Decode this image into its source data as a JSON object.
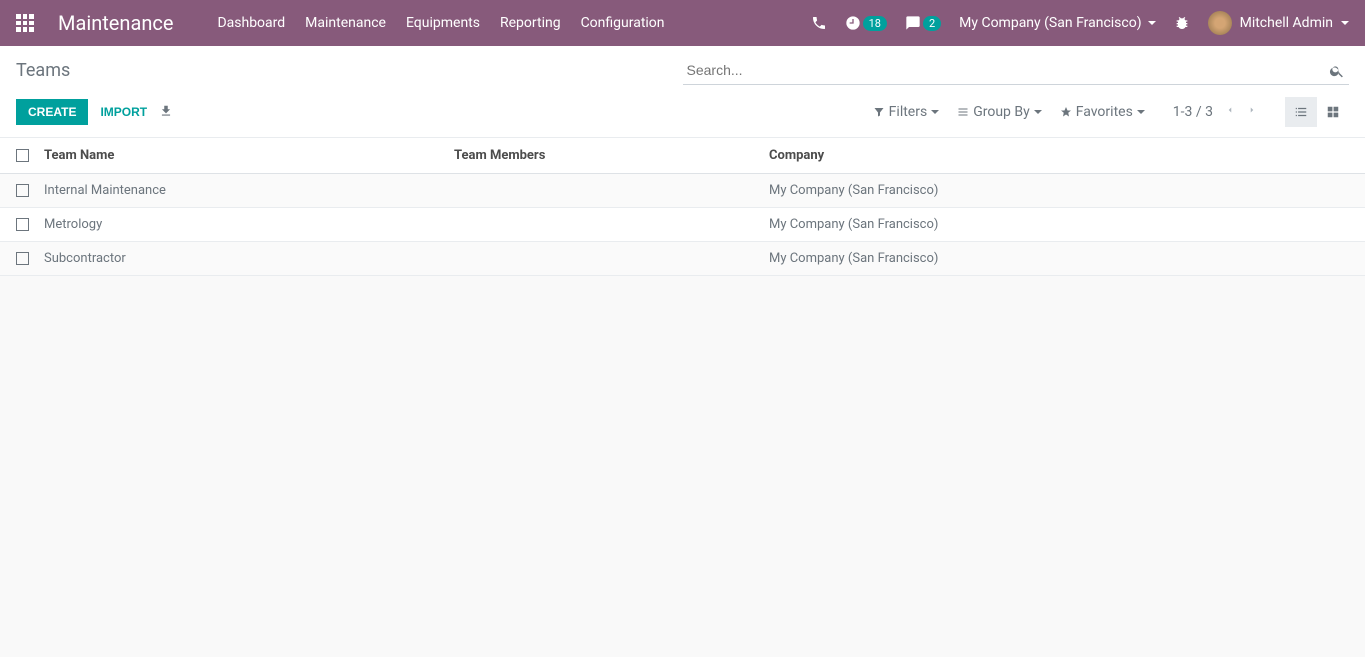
{
  "navbar": {
    "app_title": "Maintenance",
    "menu": [
      "Dashboard",
      "Maintenance",
      "Equipments",
      "Reporting",
      "Configuration"
    ],
    "activities_badge": "18",
    "messages_badge": "2",
    "company": "My Company (San Francisco)",
    "user": "Mitchell Admin"
  },
  "control_panel": {
    "breadcrumb": "Teams",
    "search_placeholder": "Search...",
    "create_label": "CREATE",
    "import_label": "IMPORT",
    "filters_label": "Filters",
    "groupby_label": "Group By",
    "favorites_label": "Favorites",
    "pager": "1-3 / 3"
  },
  "table": {
    "headers": {
      "name": "Team Name",
      "members": "Team Members",
      "company": "Company"
    },
    "rows": [
      {
        "name": "Internal Maintenance",
        "members": "",
        "company": "My Company (San Francisco)"
      },
      {
        "name": "Metrology",
        "members": "",
        "company": "My Company (San Francisco)"
      },
      {
        "name": "Subcontractor",
        "members": "",
        "company": "My Company (San Francisco)"
      }
    ]
  }
}
